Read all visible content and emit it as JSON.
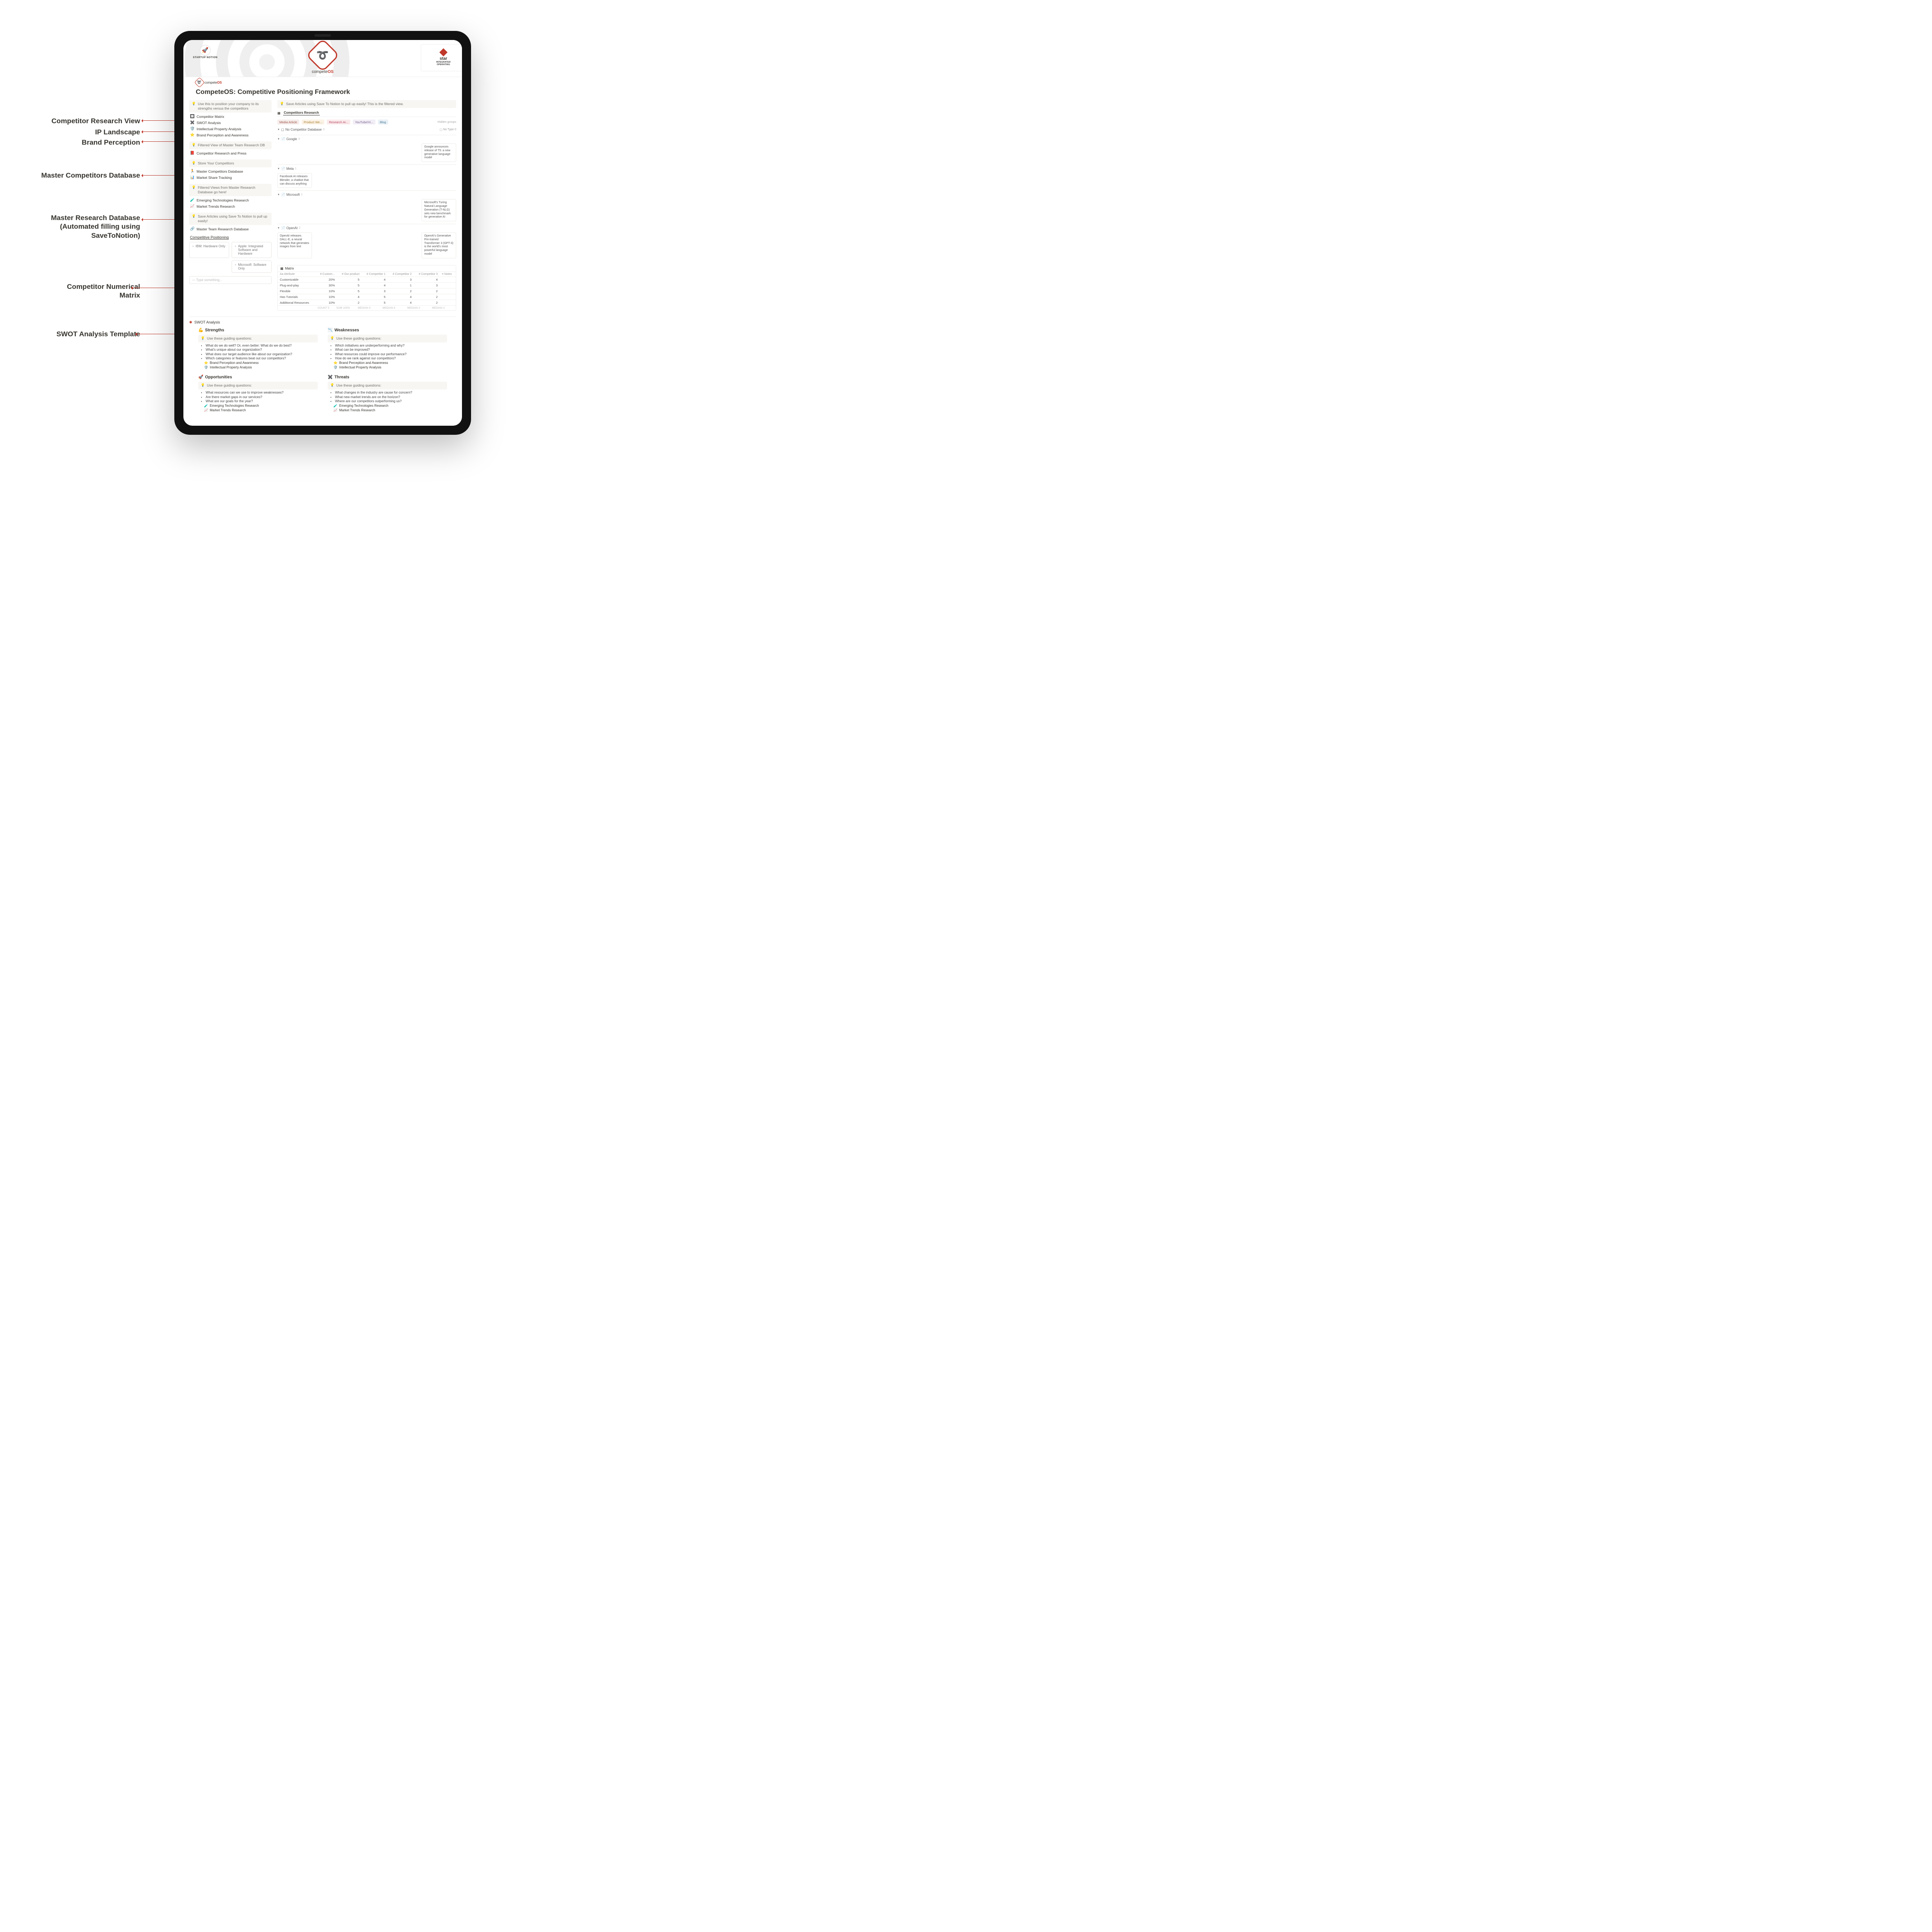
{
  "labels": {
    "research_view": "Competitor Research View",
    "ip": "IP Landscape",
    "brand": "Brand Perception",
    "competitors_db": "Master Competitors Database",
    "research_db": "Master Research Database\n(Automated filling using\nSaveToNotion)",
    "matrix": "Competitor Numerical\nMatrix",
    "swot": "SWOT Analysis Template"
  },
  "header": {
    "left_badge": "STARTUP NOTION",
    "brand": {
      "prefix": "compete",
      "suffix": "OS"
    },
    "right_title": "star",
    "right_sub1": "INTEGRATED",
    "right_sub2": "OPERATING",
    "sublogo": "competeOS"
  },
  "page_title": "CompeteOS: Competitive Positioning Framework",
  "left": {
    "callout1": "Use this to position your company to its strengths versus the competitors",
    "nav1": [
      {
        "icon": "🔲",
        "label": "Competitor Matrix",
        "color": "red"
      },
      {
        "icon": "✖️",
        "label": "SWOT Analysis",
        "color": "red"
      },
      {
        "icon": "🛡️",
        "label": "Intellectual Property Analysis",
        "color": "red"
      },
      {
        "icon": "⭐",
        "label": "Brand Perception and Awareness",
        "color": "red"
      }
    ],
    "callout2": "Filtered View of Master Team Research DB",
    "nav2": [
      {
        "icon": "📕",
        "label": "Competitor Research and Press"
      }
    ],
    "callout3": "Store Your Competitors",
    "nav3": [
      {
        "icon": "🏃",
        "label": "Master Competitors Database",
        "color": "red"
      },
      {
        "icon": "📊",
        "label": "Market Share Tracking",
        "color": "red"
      }
    ],
    "callout4": "Filtered Views from Master Research Database go here!",
    "nav4": [
      {
        "icon": "🧪",
        "label": "Emerging Technologies Research",
        "color": "red"
      },
      {
        "icon": "📈",
        "label": "Market Trends Research",
        "color": "red"
      }
    ],
    "callout5": "Save Articles using Save To Notion to pull up easily!",
    "nav5": [
      {
        "icon": "🔗",
        "label": "Master Team Research Database",
        "color": "red"
      }
    ],
    "section_heading": "Competitive Positioning",
    "chips": [
      "IBM: Hardware Only",
      "Apple: Integrated Software and Hardware",
      "Microsoft: Software Only"
    ],
    "type_placeholder": "Type something..."
  },
  "research": {
    "callout": "Save Articles using Save To Notion to pull up easily! This is the filtered view.",
    "tab": "Competitors Research",
    "filters": [
      "Media Article",
      "Product We...",
      "Research Ar...",
      "YouTube/Vi...",
      "Blog"
    ],
    "hidden_label": "Hidden groups",
    "notype_label": "No Type",
    "notype_count": "0",
    "no_db_group": "No Competitor Database",
    "no_db_count": "0",
    "groups": [
      {
        "name": "Google",
        "count": "3",
        "cells": [
          null,
          null,
          null,
          null,
          "Google announces release of T5: a new generative language model"
        ]
      },
      {
        "name": "Meta",
        "count": "1",
        "cells": [
          "Facebook AI releases Blender, a chatbot that can discuss anything",
          null,
          null,
          null,
          null
        ]
      },
      {
        "name": "Microsoft",
        "count": "1",
        "cells": [
          null,
          null,
          null,
          null,
          "Microsoft's Turing Natural Language Generation (T-NLG) sets new benchmark for generative AI"
        ]
      },
      {
        "name": "OpenAI",
        "count": "2",
        "cells": [
          "OpenAI releases DALL-E, a neural network that generates images from text",
          null,
          null,
          null,
          "OpenAI's Generative Pre-trained Transformer 3 (GPT-3) is the world's most powerful language model"
        ]
      }
    ]
  },
  "matrix": {
    "title": "Matrix",
    "headers": [
      "Aa Attribute",
      "# Custom...",
      "# Our product",
      "# Competitor 1",
      "# Competitor 2",
      "# Competitor 3",
      "≡ Notes"
    ],
    "rows": [
      [
        "Customizable",
        "20%",
        "5",
        "4",
        "3",
        "4",
        ""
      ],
      [
        "Plug-and-play",
        "30%",
        "5",
        "4",
        "1",
        "3",
        ""
      ],
      [
        "Flexible",
        "10%",
        "5",
        "3",
        "2",
        "2",
        ""
      ],
      [
        "Has Tutorials",
        "10%",
        "4",
        "5",
        "4",
        "2",
        ""
      ],
      [
        "Additional Resources",
        "10%",
        "2",
        "5",
        "4",
        "2",
        ""
      ]
    ],
    "footer": [
      "COUNT 5",
      "SUM 100%",
      "MEDIAN 5",
      "MEDIAN 4",
      "MEDIAN 3",
      "MEDIAN 2",
      ""
    ]
  },
  "swot": {
    "title": "SWOT Analysis",
    "guiding": "Use these guiding questions:",
    "strengths": {
      "h": "Strengths",
      "icon": "💪",
      "qs": [
        "What do we do well? Or, even better: What do we do best?",
        "What's unique about our organization?",
        "What does our target audience like about our organization?",
        "Which categories or features beat out our competitors?"
      ],
      "links": [
        {
          "icon": "⭐",
          "label": "Brand Perception and Awareness"
        },
        {
          "icon": "🛡️",
          "label": "Intellectual Property Analysis"
        }
      ]
    },
    "weaknesses": {
      "h": "Weaknesses",
      "icon": "📉",
      "qs": [
        "Which initiatives are underperforming and why?",
        "What can be improved?",
        "What resources could improve our performance?",
        "How do we rank against our competitors?"
      ],
      "links": [
        {
          "icon": "⭐",
          "label": "Brand Perception and Awareness"
        },
        {
          "icon": "🛡️",
          "label": "Intellectual Property Analysis"
        }
      ]
    },
    "opportunities": {
      "h": "Opportunities",
      "icon": "🚀",
      "qs": [
        "What resources can we use to improve weaknesses?",
        "Are there market gaps in our services?",
        "What are our goals for the year?"
      ],
      "links": [
        {
          "icon": "🧪",
          "label": "Emerging Technologies Research"
        },
        {
          "icon": "📈",
          "label": "Market Trends Research"
        }
      ]
    },
    "threats": {
      "h": "Threats",
      "icon": "✖️",
      "qs": [
        "What changes in the industry are cause for concern?",
        "What new market trends are on the horizon?",
        "Where are our competitors outperforming us?"
      ],
      "links": [
        {
          "icon": "🧪",
          "label": "Emerging Technologies Research"
        },
        {
          "icon": "📈",
          "label": "Market Trends Research"
        }
      ]
    }
  }
}
